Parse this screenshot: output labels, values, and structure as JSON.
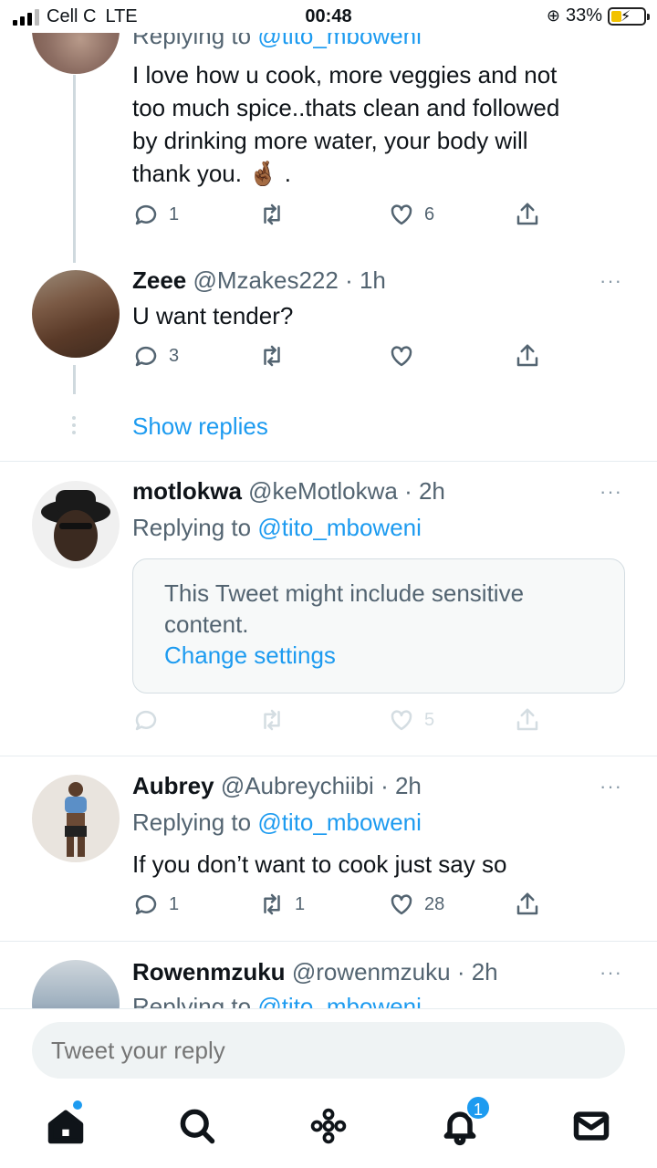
{
  "status_bar": {
    "carrier": "Cell C",
    "network": "LTE",
    "time": "00:48",
    "battery_percent": "33%",
    "battery_level": 0.33
  },
  "tweets": [
    {
      "replying_label": "Replying to",
      "replying_handle": "@tito_mboweni",
      "text_lines": [
        "I love how u cook, more veggies and not",
        "too much spice..thats clean and followed",
        "by drinking more water, your body will",
        "thank you. 🤞🏾 ."
      ],
      "reply_count": "1",
      "retweet_count": "",
      "like_count": "6"
    },
    {
      "name": "Zeee",
      "handle": "@Mzakes222",
      "time": "· 1h",
      "text": "U want tender?",
      "reply_count": "3",
      "retweet_count": "",
      "like_count": ""
    },
    {
      "name": "motlokwa",
      "handle": "@keMotlokwa",
      "time": "· 2h",
      "replying_label": "Replying to",
      "replying_handle": "@tito_mboweni",
      "sensitive_line1": "This Tweet might include sensitive",
      "sensitive_line2": "content.",
      "change_settings": "Change settings",
      "reply_count": "",
      "retweet_count": "",
      "like_count": "5"
    },
    {
      "name": "Aubrey",
      "handle": "@Aubreychiibi",
      "time": "· 2h",
      "replying_label": "Replying to",
      "replying_handle": "@tito_mboweni",
      "text": "If you don’t want to cook just say so",
      "reply_count": "1",
      "retweet_count": "1",
      "like_count": "28"
    },
    {
      "name": "Rowenmzuku",
      "handle": "@rowenmzuku",
      "time": "· 2h",
      "replying_label": "Replying to",
      "replying_handle": "@tito_mboweni"
    }
  ],
  "show_replies": "Show replies",
  "more_icon": "···",
  "reply_placeholder": "Tweet your reply",
  "tabbar": {
    "notifications_badge": "1",
    "items": [
      "home-icon",
      "search-icon",
      "spaces-icon",
      "notifications-icon",
      "messages-icon"
    ]
  },
  "colors": {
    "accent": "#1d9bf0",
    "muted": "#536471",
    "divider": "#e6ecf0"
  }
}
